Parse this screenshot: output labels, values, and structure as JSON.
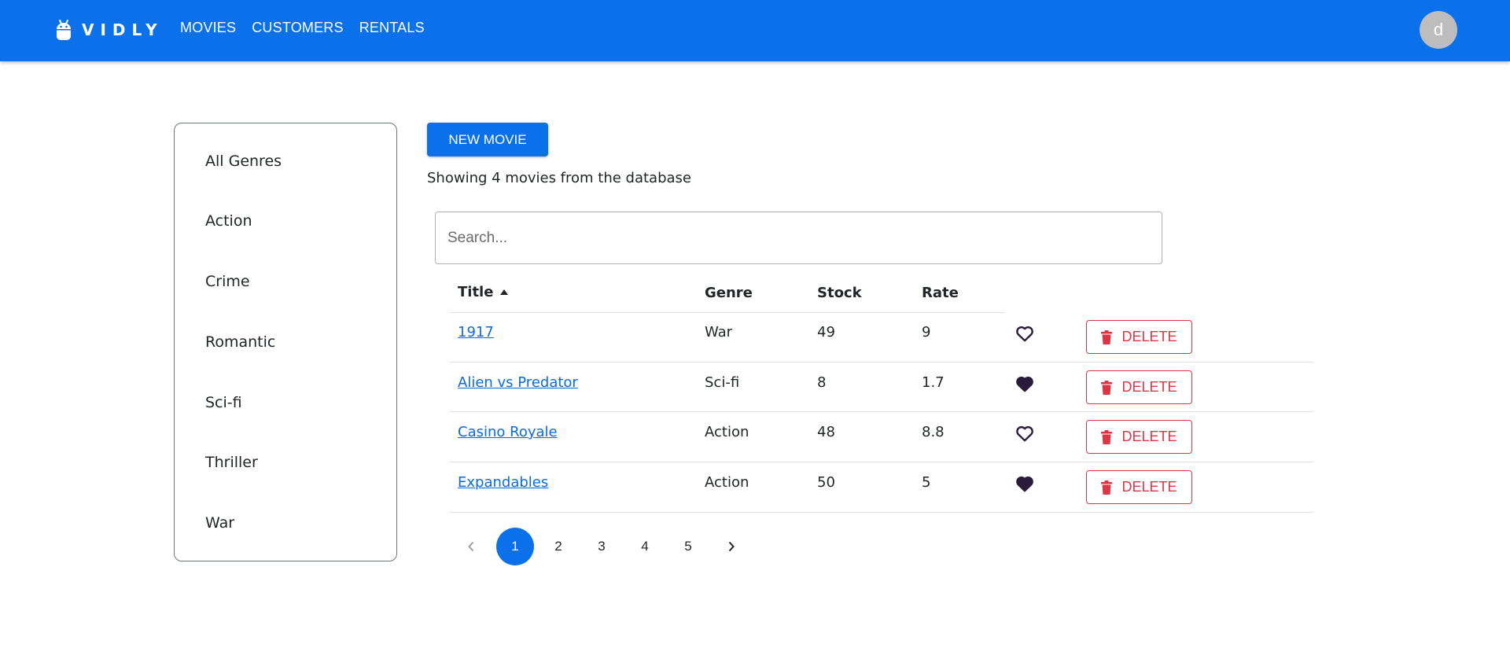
{
  "app": {
    "brand": "VIDLY",
    "avatar_initial": "d"
  },
  "nav": {
    "items": [
      "MOVIES",
      "CUSTOMERS",
      "RENTALS"
    ]
  },
  "sidebar": {
    "genres": [
      "All Genres",
      "Action",
      "Crime",
      "Romantic",
      "Sci-fi",
      "Thriller",
      "War"
    ]
  },
  "main": {
    "new_movie_label": "NEW MOVIE",
    "summary": "Showing 4 movies from the database",
    "search_placeholder": "Search..."
  },
  "table": {
    "columns": [
      "Title",
      "Genre",
      "Stock",
      "Rate"
    ],
    "delete_label": "DELETE",
    "rows": [
      {
        "title": "1917",
        "genre": "War",
        "stock": "49",
        "rate": "9",
        "liked": false
      },
      {
        "title": "Alien vs Predator",
        "genre": "Sci-fi",
        "stock": "8",
        "rate": "1.7",
        "liked": true
      },
      {
        "title": "Casino Royale",
        "genre": "Action",
        "stock": "48",
        "rate": "8.8",
        "liked": false
      },
      {
        "title": "Expandables",
        "genre": "Action",
        "stock": "50",
        "rate": "5",
        "liked": true
      }
    ]
  },
  "pagination": {
    "pages": [
      "1",
      "2",
      "3",
      "4",
      "5"
    ],
    "current": "1"
  },
  "colors": {
    "primary": "#0a71ea",
    "danger": "#dc3545",
    "heart": "#2a1b3d"
  }
}
